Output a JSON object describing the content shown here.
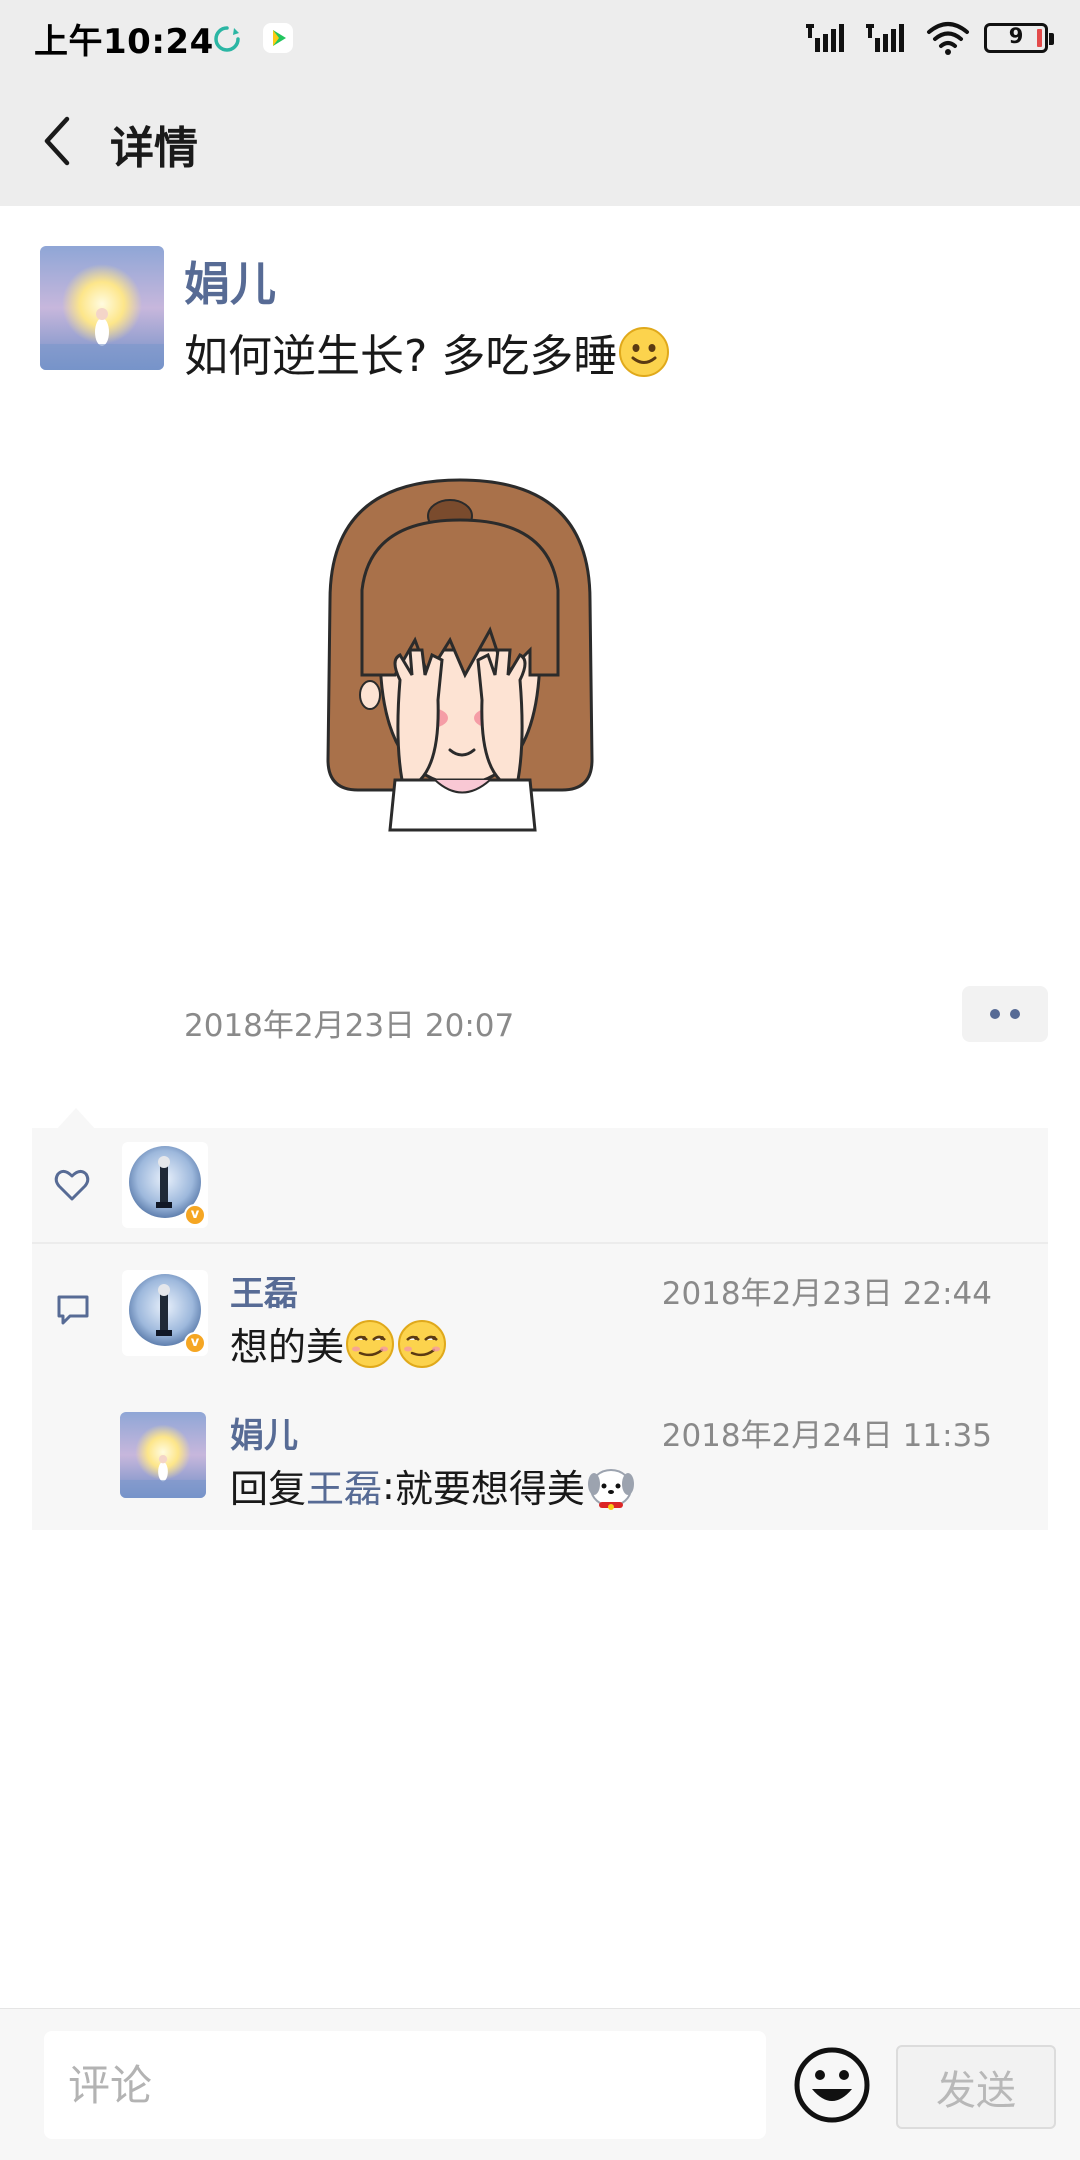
{
  "status_bar": {
    "time": "上午10:24",
    "battery_level": "9",
    "icons": [
      "sync-icon",
      "video-app-icon",
      "signal-icon",
      "signal-icon",
      "wifi-icon",
      "battery-icon"
    ]
  },
  "header": {
    "title": "详情",
    "back_icon": "chevron-left-icon"
  },
  "post": {
    "author": "娟儿",
    "text": "如何逆生长? 多吃多睡",
    "text_emoji": "smile-emoji",
    "image": "cartoon-girl-covering-face",
    "time": "2018年2月23日 20:07",
    "more_icon": "two-dots-icon"
  },
  "likes": {
    "icon": "heart-outline-icon",
    "users": [
      "王磊"
    ]
  },
  "comments": [
    {
      "author": "王磊",
      "time": "2018年2月23日 22:44",
      "text": "想的美",
      "emojis": [
        "smirk-emoji",
        "smirk-emoji"
      ]
    },
    {
      "author": "娟儿",
      "time": "2018年2月24日 11:35",
      "reply_prefix": "回复",
      "reply_to": "王磊",
      "separator": ": ",
      "text": "就要想得美",
      "emojis": [
        "puppy-emoji"
      ]
    }
  ],
  "input_bar": {
    "placeholder": "评论",
    "value": "",
    "send_label": "发送"
  },
  "colors": {
    "link": "#576b95",
    "header_bg": "#ededed",
    "panel_bg": "#f7f7f7",
    "text": "#191919",
    "muted": "#8a8a8a"
  }
}
